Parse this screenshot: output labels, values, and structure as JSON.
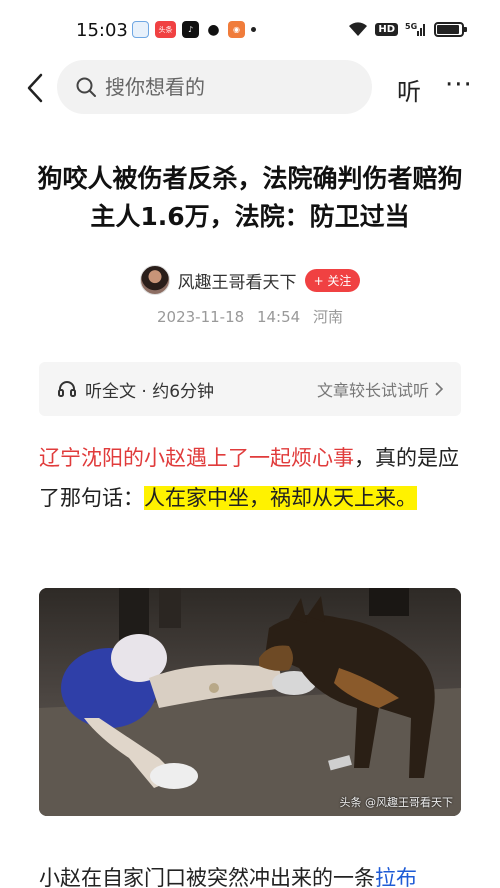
{
  "status_bar": {
    "time": "15:03",
    "app_toutiao": "头条",
    "network": "HD",
    "signal": "5G"
  },
  "nav": {
    "search_placeholder": "搜你想看的",
    "listen_label": "听",
    "more_label": "···"
  },
  "article": {
    "title": "狗咬人被伤者反杀，法院确判伤者赔狗主人1.6万，法院：防卫过当",
    "author": "风趣王哥看天下",
    "follow_label": "+ 关注",
    "date": "2023-11-18",
    "time": "14:54",
    "location": "河南",
    "listen_bar": {
      "left_label": "听全文 · 约6分钟",
      "right_label": "文章较长试试听"
    },
    "para1": {
      "red_text": "辽宁沈阳的小赵遇上了一起烦心事",
      "mid_text": "，真的是应了那句话：",
      "highlight_text": "人在家中坐，祸却从天上来。"
    },
    "image_caption": "头条 @风趣王哥看天下",
    "para2": {
      "text": "小赵在自家门口被突然冲出来的一条",
      "link_text": "拉布"
    }
  },
  "colors": {
    "accent_red": "#f04142",
    "highlight": "#fff200",
    "link": "#1e5bd6"
  }
}
